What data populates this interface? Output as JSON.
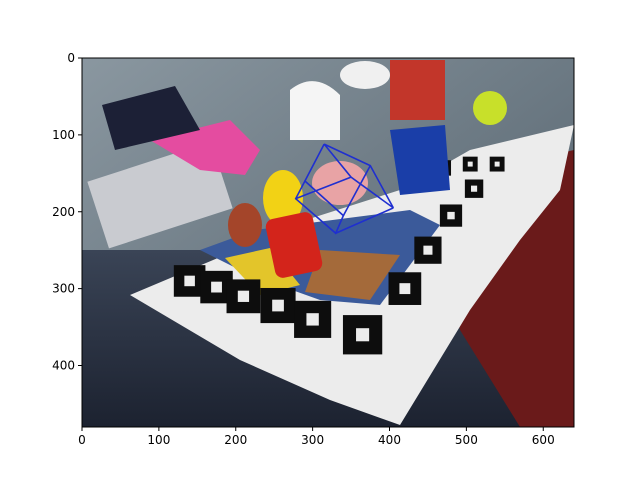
{
  "chart_data": {
    "type": "image",
    "title": "",
    "xlabel": "",
    "ylabel": "",
    "image_size": [
      640,
      480
    ],
    "xlim": [
      0,
      640
    ],
    "ylim": [
      480,
      0
    ],
    "xticks": [
      0,
      100,
      200,
      300,
      400,
      500,
      600
    ],
    "yticks": [
      0,
      100,
      200,
      300,
      400
    ],
    "xtick_labels": [
      "0",
      "100",
      "200",
      "300",
      "400",
      "500",
      "600"
    ],
    "ytick_labels": [
      "0",
      "100",
      "200",
      "300",
      "400"
    ],
    "grid": false,
    "overlay": {
      "type": "wireframe-cube",
      "color": "#1f2fd0",
      "front_face": [
        [
          290,
          160
        ],
        [
          340,
          205
        ],
        [
          330,
          228
        ],
        [
          278,
          183
        ]
      ],
      "back_face": [
        [
          315,
          112
        ],
        [
          375,
          140
        ],
        [
          405,
          195
        ],
        [
          350,
          155
        ]
      ],
      "edges": [
        [
          0,
          0
        ],
        [
          1,
          1
        ],
        [
          2,
          2
        ],
        [
          3,
          3
        ]
      ]
    },
    "scene": {
      "description_free": true,
      "board_color": "#f2f2f2",
      "marker_color": "#0d0d0d",
      "background_wall": "#6e7d87",
      "floor_color": "#2b3445",
      "book_color": "#7a1d1d"
    }
  }
}
